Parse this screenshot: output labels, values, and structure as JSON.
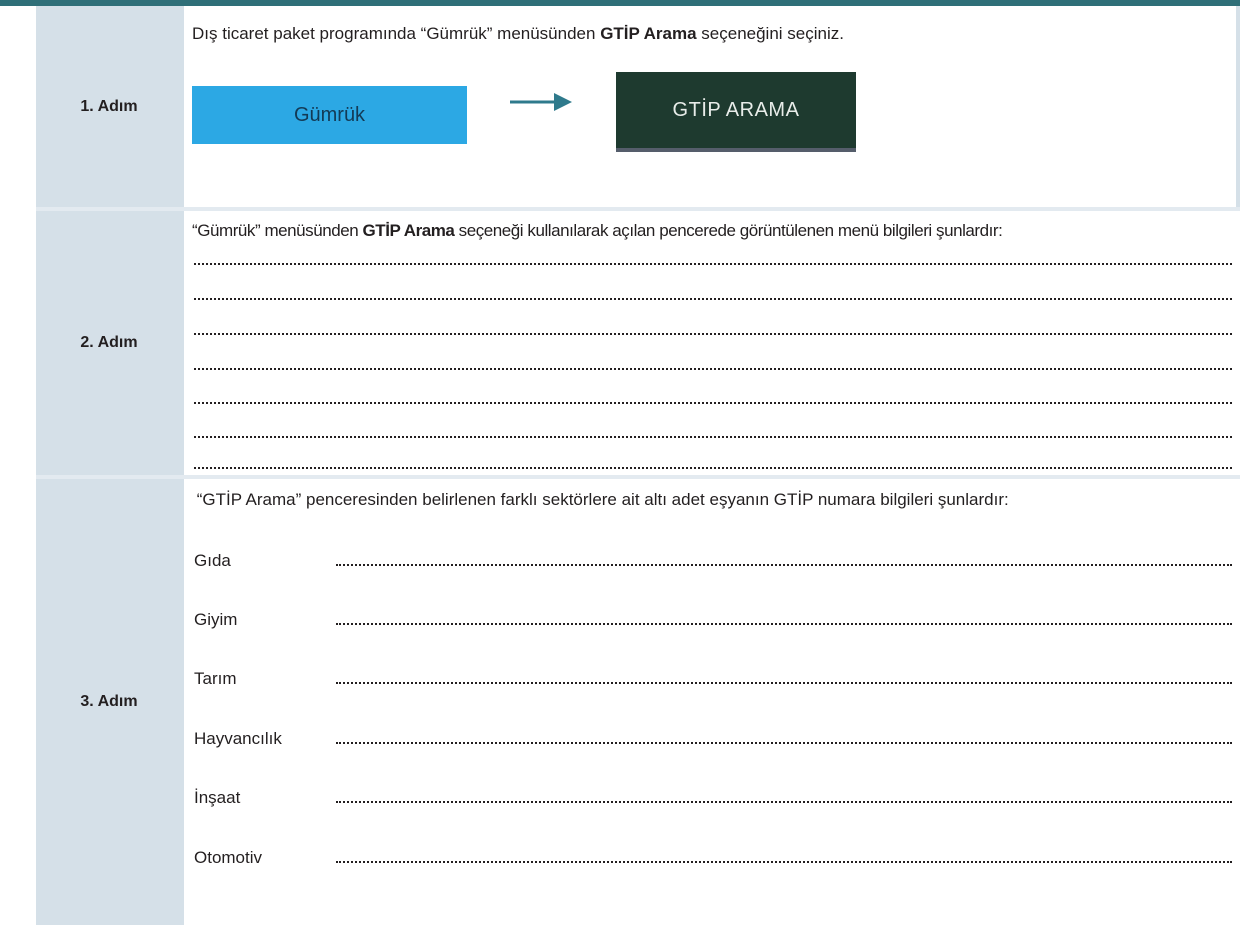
{
  "steps": [
    {
      "label": "1. Adım"
    },
    {
      "label": "2. Adım"
    },
    {
      "label": "3. Adım"
    }
  ],
  "step1": {
    "instruction_pre": "Dış ticaret paket programında “Gümrük” menüsünden ",
    "instruction_bold": "GTİP Arama",
    "instruction_post": " seçeneğini seçiniz.",
    "gumruk_button_label": "Gümrük",
    "gtip_button_label": "GTİP ARAMA"
  },
  "step2": {
    "instruction_pre": "“Gümrük” menüsünden ",
    "instruction_bold": "GTİP Arama",
    "instruction_post": " seçeneği kullanılarak açılan pencerede görüntülenen menü bilgileri şunlardır:"
  },
  "step3": {
    "instruction": " “GTİP Arama” penceresinden belirlenen farklı sektörlere ait altı adet eşyanın GTİP numara bilgileri şunlardır:",
    "sectors": [
      "Gıda",
      "Giyim",
      "Tarım",
      "Hayvancılık",
      "İnşaat",
      "Otomotiv"
    ]
  },
  "colors": {
    "step_cell": "#d5e0e8",
    "gumruk_button": "#2ca8e4",
    "gtip_button": "#1e3a2f",
    "arrow": "#2f7a8c",
    "top_bar": "#2f6f78"
  }
}
